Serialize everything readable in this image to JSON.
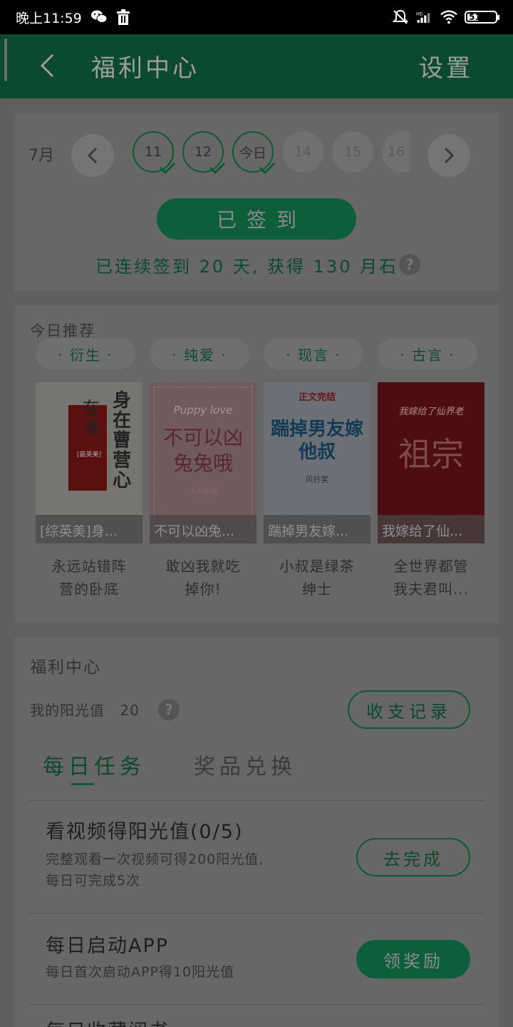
{
  "status_bar": {
    "time": "晚上11:59",
    "network_label": "HD",
    "battery": "51",
    "icons": [
      "wechat-icon",
      "trash-icon",
      "mute-icon",
      "signal-icon",
      "wifi-icon",
      "battery-icon"
    ]
  },
  "app_bar": {
    "title": "福利中心",
    "settings": "设置"
  },
  "signin": {
    "month": "7月",
    "days": [
      {
        "label": "11",
        "checked": true
      },
      {
        "label": "12",
        "checked": true
      },
      {
        "label": "今日",
        "checked": true
      },
      {
        "label": "14",
        "checked": false
      },
      {
        "label": "15",
        "checked": false
      },
      {
        "label": "16",
        "checked": false
      }
    ],
    "button": "已签到",
    "streak_text": "已连续签到 20 天, 获得 130 月石",
    "help": "?"
  },
  "recommend": {
    "title": "今日推荐",
    "chips": [
      "· 衍生 ·",
      "· 纯爱 ·",
      "· 现言 ·",
      "· 古言 ·"
    ],
    "books": [
      {
        "overlay": "[综英美]身...",
        "desc_line1": "永远站错阵",
        "desc_line2": "营的卧底",
        "cover_main": "身在曹营心",
        "cover_sub": "在漢",
        "cover_tag": "[篇英美]"
      },
      {
        "overlay": "不可以凶兔...",
        "desc_line1": "敢凶我就吃",
        "desc_line2": "掉你!",
        "cover_main": "不可以凶兔兔哦",
        "cover_sub": "Puppy love",
        "cover_tag": "人间蜜糖"
      },
      {
        "overlay": "踹掉男友嫁...",
        "desc_line1": "小叔是绿茶",
        "desc_line2": "绅士",
        "cover_main": "踹掉男友嫁他叔",
        "cover_sub": "正文完结",
        "cover_tag": "风钤笑"
      },
      {
        "overlay": "我嫁给了仙...",
        "desc_line1": "全世界都管",
        "desc_line2": "我夫君叫...",
        "cover_main": "祖宗",
        "cover_sub": "我嫁给了仙界老",
        "cover_tag": ""
      }
    ]
  },
  "welfare": {
    "title": "福利中心",
    "sunshine_label": "我的阳光值",
    "sunshine_value": "20",
    "help": "?",
    "records_button": "收支记录",
    "tabs": [
      "每日任务",
      "奖品兑换"
    ],
    "tasks": [
      {
        "title": "看视频得阳光值(0/5)",
        "desc_line1": "完整观看一次视频可得200阳光值,",
        "desc_line2": "每日可完成5次",
        "button": "去完成"
      },
      {
        "title": "每日启动APP",
        "desc_line1": "每日首次启动APP得10阳光值",
        "desc_line2": "",
        "button": "领奖励"
      },
      {
        "title": "每日收藏阅书",
        "desc_line1": "",
        "desc_line2": "",
        "button": ""
      }
    ]
  },
  "colors": {
    "accent": "#0c5a36",
    "appbar": "#0c4a2f",
    "dim_background": "#5f5f5f"
  }
}
